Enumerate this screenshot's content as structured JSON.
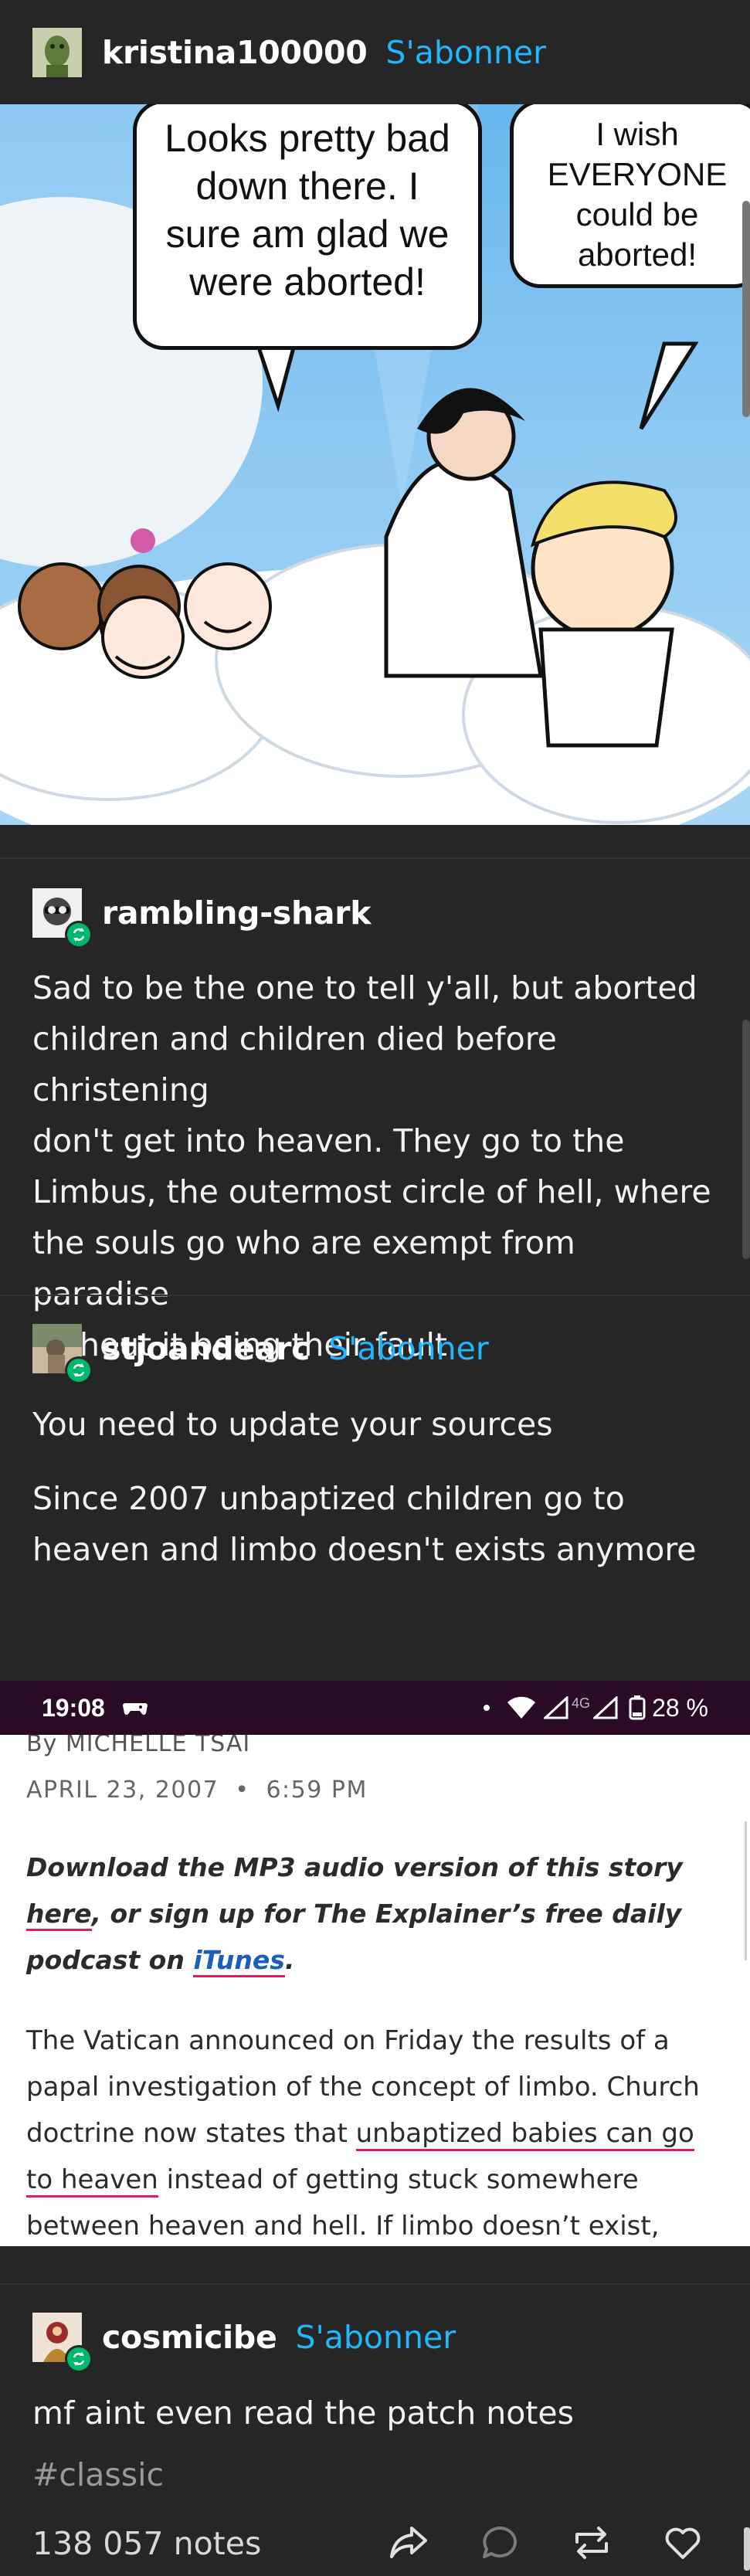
{
  "posts": [
    {
      "username": "kristina100000",
      "follow": "S'abonner"
    },
    {
      "username": "rambling-shark",
      "lines": [
        "Sad to be the one to tell y'all, but aborted",
        "children and children died before christening",
        "don't get into heaven. They go to the",
        "Limbus, the outermost circle of hell, where",
        "the souls go who are exempt from paradise",
        "without it being their fault"
      ]
    },
    {
      "username": "stjoandearc",
      "follow": "S'abonner",
      "line1": "You need to update your sources",
      "line2a": "Since 2007 unbaptized children go to",
      "line2b": "heaven and limbo doesn't exists anymore"
    },
    {
      "username": "cosmicibe",
      "follow": "S'abonner",
      "text": "mf aint even read the patch notes",
      "tag": "#classic"
    }
  ],
  "comic": {
    "bubble_left": [
      "Looks pretty bad",
      "down there. I",
      "sure am glad we",
      "were aborted!"
    ],
    "bubble_right": [
      "I wish",
      "EVERYONE",
      "could be",
      "aborted!"
    ]
  },
  "statusbar": {
    "time": "19:08",
    "network": "4G",
    "battery": "28 %"
  },
  "article": {
    "byline": "By MICHELLE TSAI",
    "date": "APRIL 23, 2007",
    "sep": "•",
    "time": "6:59 PM",
    "promo_1": "Download the MP3 audio version of this story",
    "promo_here": "here",
    "promo_2": ", or sign up for The Explainer’s free daily",
    "promo_3": "podcast on ",
    "promo_itunes": "iTunes",
    "promo_dot": ".",
    "p1": "The Vatican announced on Friday the results of a",
    "p2": "papal investigation of the concept of limbo. Church",
    "p3a": "doctrine now states that ",
    "p3link": "unbaptized babies can go",
    "p4link": "to heaven",
    "p4b": " instead of getting stuck somewhere",
    "p5": "between heaven and hell. If limbo doesn’t exist,"
  },
  "footer": {
    "notes": "138 057 notes"
  },
  "colors": {
    "background": "#262626",
    "accent": "#1fb8ff",
    "reblog": "#00b86b",
    "link_underline": "#e21a5c"
  }
}
